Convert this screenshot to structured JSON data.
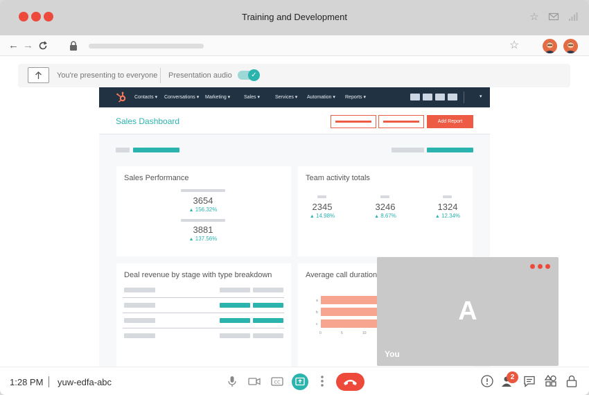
{
  "window": {
    "title": "Training and Development"
  },
  "presenting": {
    "status_text": "You're presenting to everyone",
    "audio_label": "Presentation audio",
    "audio_on": true
  },
  "hubspot": {
    "nav_items": [
      "Contacts",
      "Conversations",
      "Marketing",
      "Sales",
      "Services",
      "Automation",
      "Reports"
    ],
    "dashboard_title": "Sales Dashboard",
    "add_report_label": "Add Report",
    "cards": {
      "sales_performance": {
        "title": "Sales Performance",
        "metrics": [
          {
            "value": "3654",
            "delta": "156.32%"
          },
          {
            "value": "3881",
            "delta": "137.56%"
          }
        ]
      },
      "team_activity": {
        "title": "Team activity totals",
        "metrics": [
          {
            "value": "2345",
            "delta": "14.98%"
          },
          {
            "value": "3246",
            "delta": "8.67%"
          },
          {
            "value": "1324",
            "delta": "12.34%"
          }
        ]
      },
      "deal_revenue": {
        "title": "Deal revenue by stage with type breakdown"
      },
      "avg_call": {
        "title": "Average call duration",
        "axis_ticks": [
          "0",
          "5",
          "10"
        ],
        "row_labels": [
          "a",
          "b",
          "c"
        ]
      }
    }
  },
  "self_tile": {
    "letter": "A",
    "label": "You"
  },
  "bottom_bar": {
    "time": "1:28 PM",
    "meeting_code": "yuw-edfa-abc",
    "people_badge": "2",
    "icons": [
      "mic-icon",
      "camera-icon",
      "captions-icon",
      "present-icon",
      "more-icon",
      "end-call-icon",
      "info-icon",
      "people-icon",
      "chat-icon",
      "activities-icon",
      "lock-icon"
    ]
  },
  "colors": {
    "accent_teal": "#2bb3ae",
    "brand_orange": "#ee5b44",
    "end_call_red": "#ee4a3c",
    "nav_dark": "#213343"
  }
}
